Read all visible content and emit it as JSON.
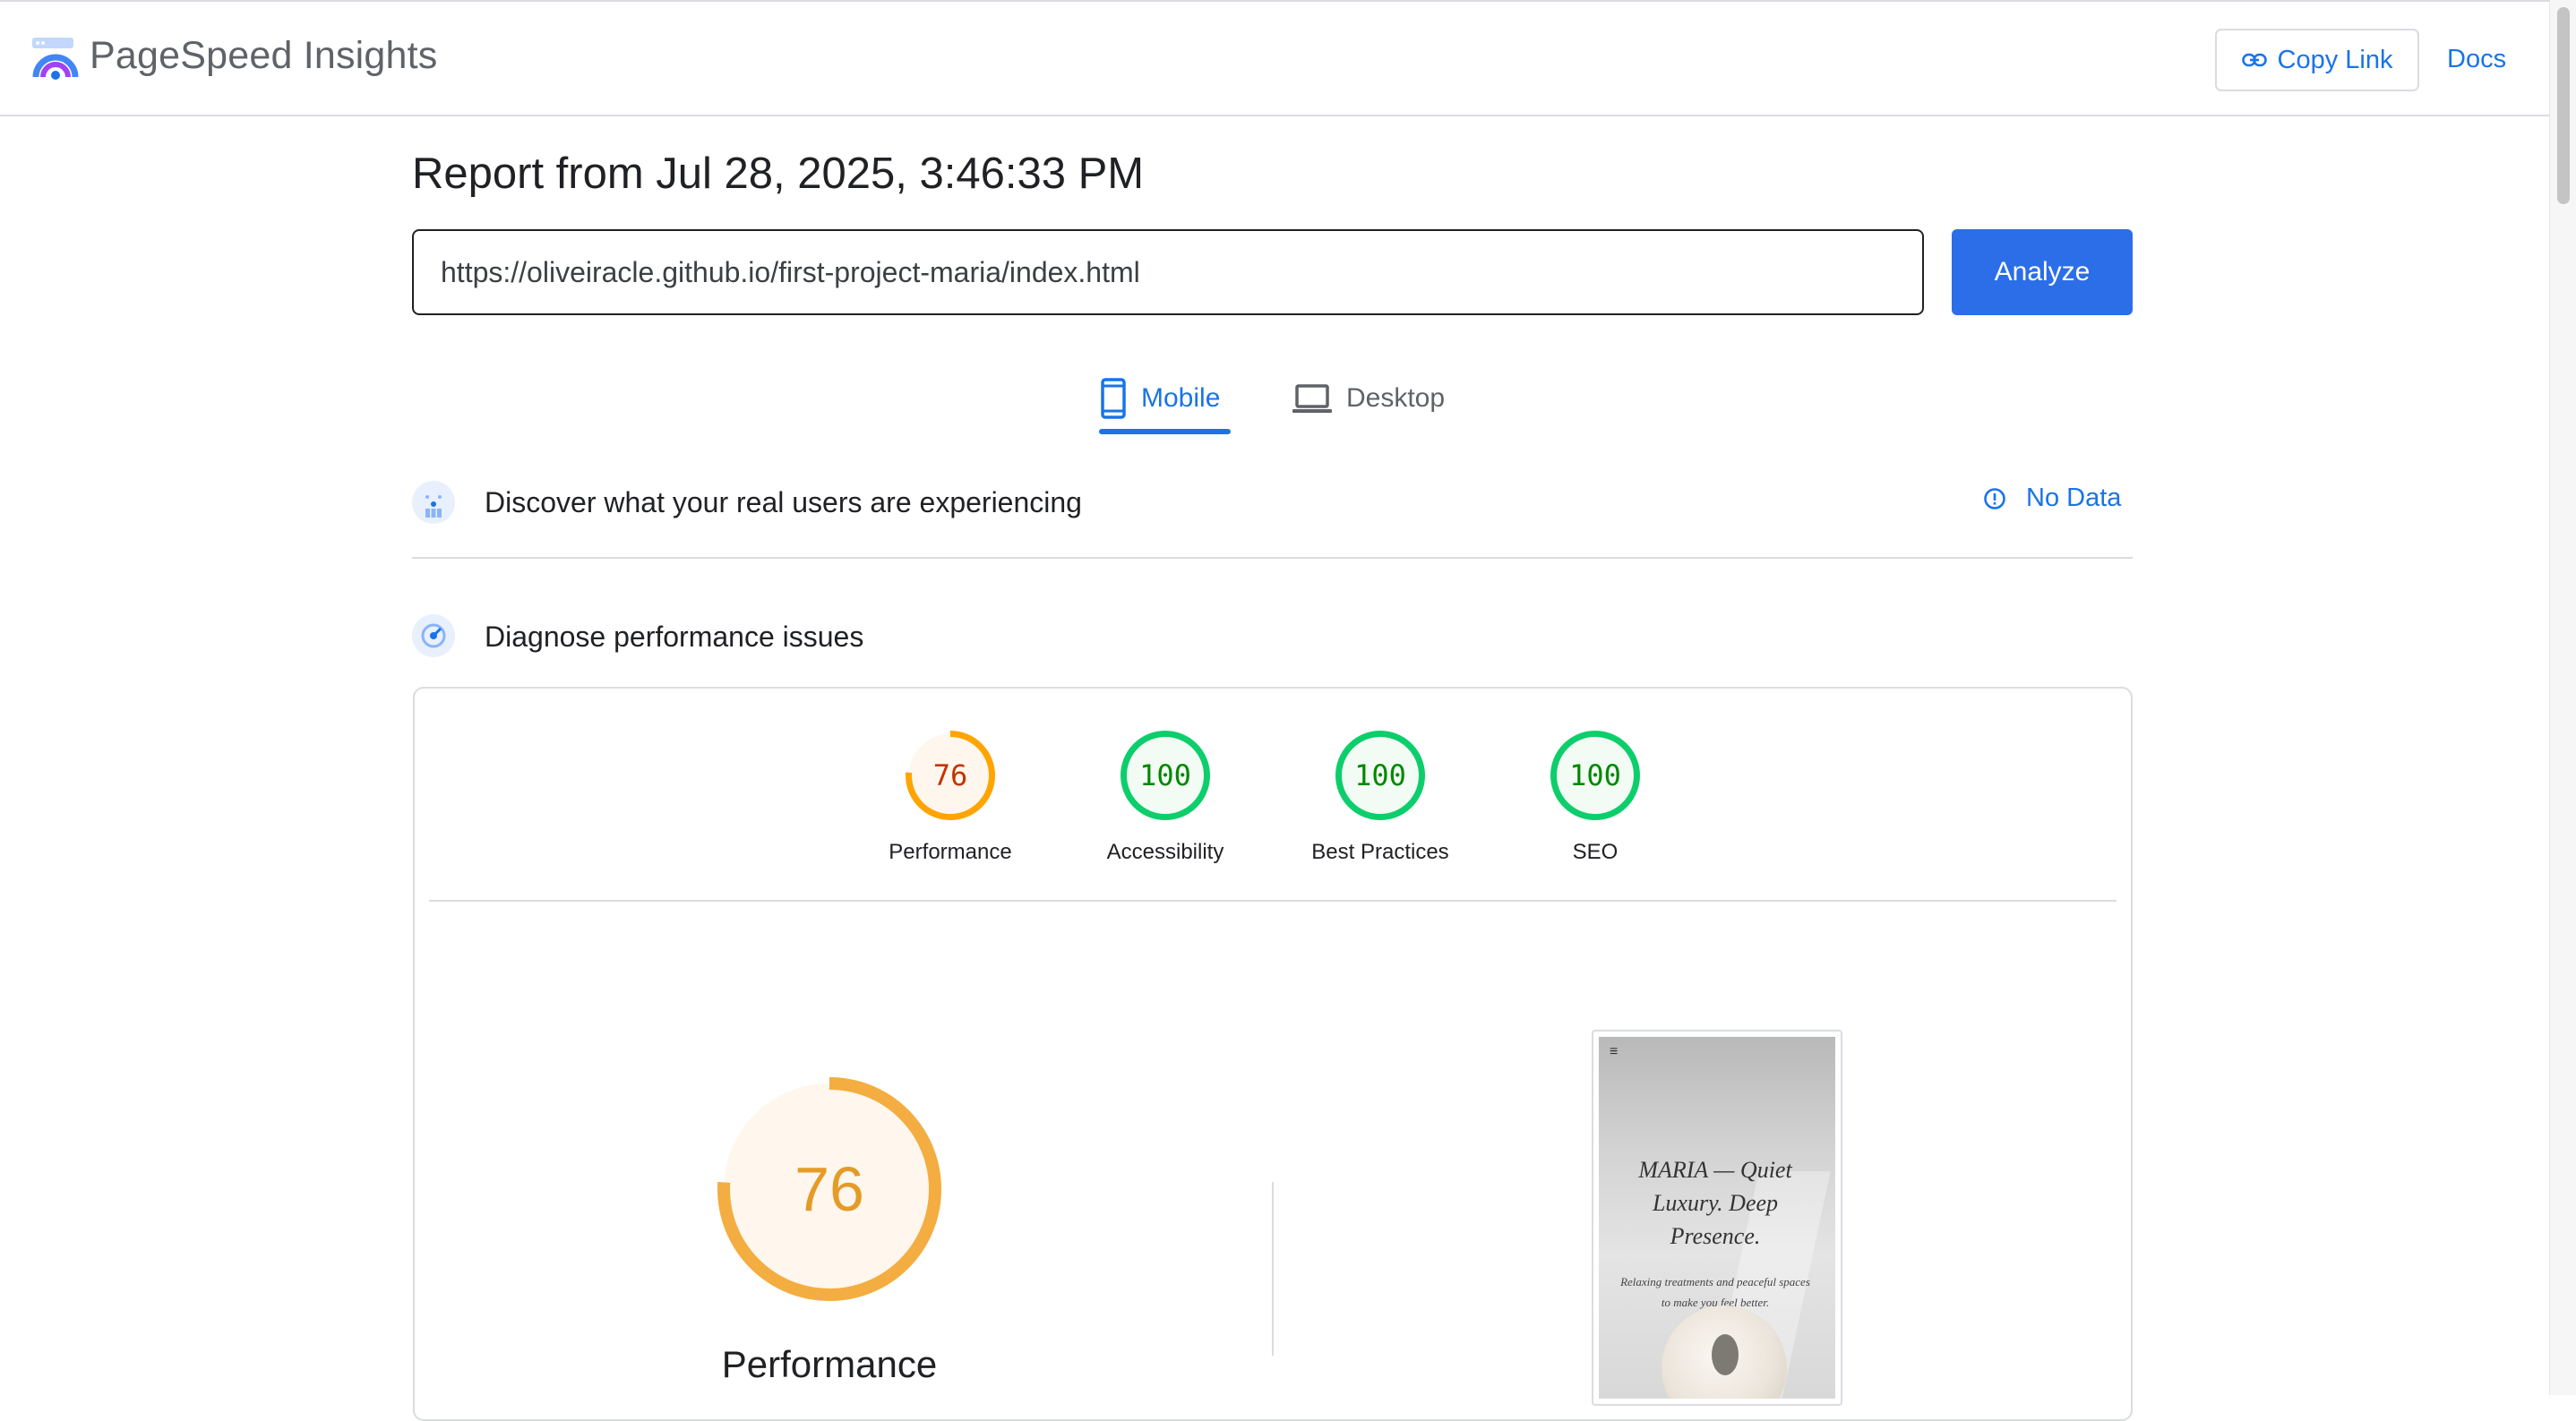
{
  "header": {
    "brand": "PageSpeed Insights",
    "copy_link_label": "Copy Link",
    "docs_label": "Docs"
  },
  "report": {
    "title": "Report from Jul 28, 2025, 3:46:33 PM",
    "url_value": "https://oliveiracle.github.io/first-project-maria/index.html",
    "analyze_label": "Analyze"
  },
  "tabs": [
    {
      "label": "Mobile",
      "active": true
    },
    {
      "label": "Desktop",
      "active": false
    }
  ],
  "field_data": {
    "title": "Discover what your real users are experiencing",
    "status": "No Data"
  },
  "lab_data": {
    "title": "Diagnose performance issues",
    "scores": [
      {
        "label": "Performance",
        "value": "76",
        "score": 76,
        "color": "#ffa400",
        "text_color": "#c33300",
        "bg": "#fff7ed"
      },
      {
        "label": "Accessibility",
        "value": "100",
        "score": 100,
        "color": "#0cce6b",
        "text_color": "#008800",
        "bg": "#f3fbf5"
      },
      {
        "label": "Best Practices",
        "value": "100",
        "score": 100,
        "color": "#0cce6b",
        "text_color": "#008800",
        "bg": "#f3fbf5"
      },
      {
        "label": "SEO",
        "value": "100",
        "score": 100,
        "color": "#0cce6b",
        "text_color": "#008800",
        "bg": "#f3fbf5"
      }
    ],
    "main_gauge": {
      "label": "Performance",
      "value": "76",
      "score": 76,
      "color": "#f3ad40",
      "text_color": "#e59b28",
      "bg": "#fff7ed"
    }
  },
  "screenshot": {
    "menu_glyph": "≡",
    "headline": "MARIA — Quiet Luxury. Deep Presence.",
    "subtext": "Relaxing treatments and peaceful spaces to make you feel better."
  },
  "colors": {
    "accent": "#1a73e8",
    "analyze_button": "#2b6ee7",
    "pass_green": "#0cce6b",
    "average_orange": "#ffa400"
  },
  "icons": {
    "logo": "pagespeed-logo-icon",
    "copy": "link-icon",
    "mobile": "smartphone-icon",
    "desktop": "laptop-icon",
    "field": "users-chart-icon",
    "info": "info-icon",
    "lab": "speedometer-icon"
  }
}
